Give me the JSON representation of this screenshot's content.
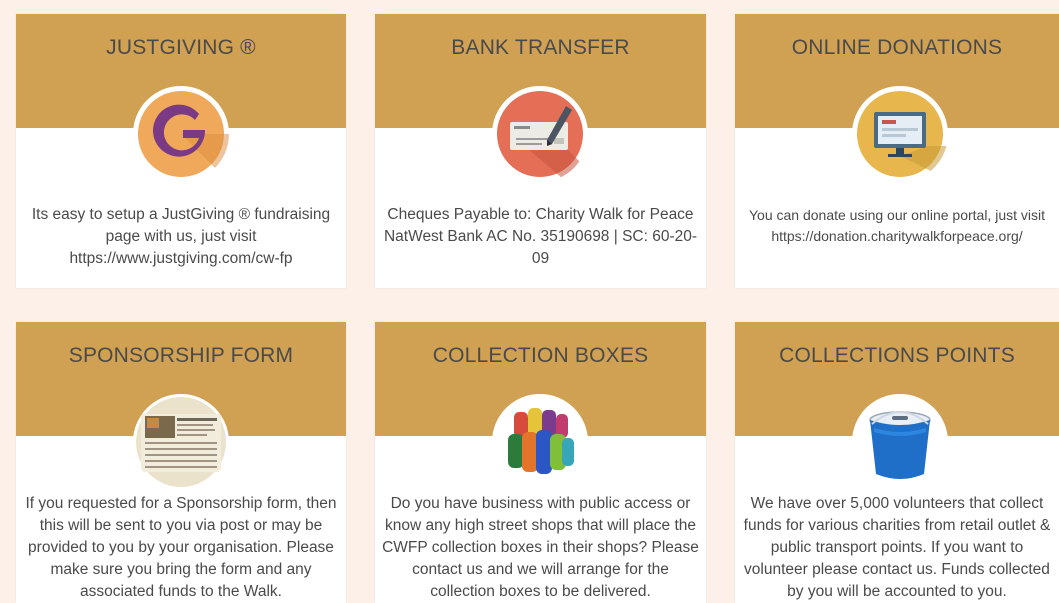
{
  "cards": [
    {
      "title": "JUSTGIVING ®",
      "icon": "justgiving-g-logo-icon",
      "text": "Its easy to setup a JustGiving ® fundraising page with us, just visit https://www.justgiving.com/cw-fp"
    },
    {
      "title": "BANK TRANSFER",
      "icon": "cheque-pen-icon",
      "text": "Cheques Payable to: Charity Walk for Peace NatWest Bank AC No. 35190698 | SC: 60-20-09"
    },
    {
      "title": "ONLINE DONATIONS",
      "icon": "computer-monitor-icon",
      "text": "You can donate using our online portal, just visit https://donation.charitywalkforpeace.org/"
    },
    {
      "title": "SPONSORSHIP FORM",
      "icon": "sponsorship-form-image",
      "text": "If you requested for a Sponsorship form, then this will be sent to you via post or may be provided to you by your organisation. Please make sure you bring the form and any associated funds to the Walk."
    },
    {
      "title": "COLLECTION BOXES",
      "icon": "collection-boxes-image",
      "text": "Do you have business with public access or know any high street shops that will place the CWFP collection boxes in their shops? Please contact us and we will arrange for the collection boxes to be delivered."
    },
    {
      "title": "COLLECTIONS POINTS",
      "icon": "blue-bucket-image",
      "text": "We have over 5,000 volunteers that collect funds for various charities from retail outlet & public transport points. If you want to volunteer please contact us. Funds collected by you will be accounted to you."
    }
  ],
  "colors": {
    "page_background": "#fcf0e9",
    "header_band": "#d1a153",
    "title_text": "#4a4a4a",
    "body_text": "#4a4a4a"
  }
}
